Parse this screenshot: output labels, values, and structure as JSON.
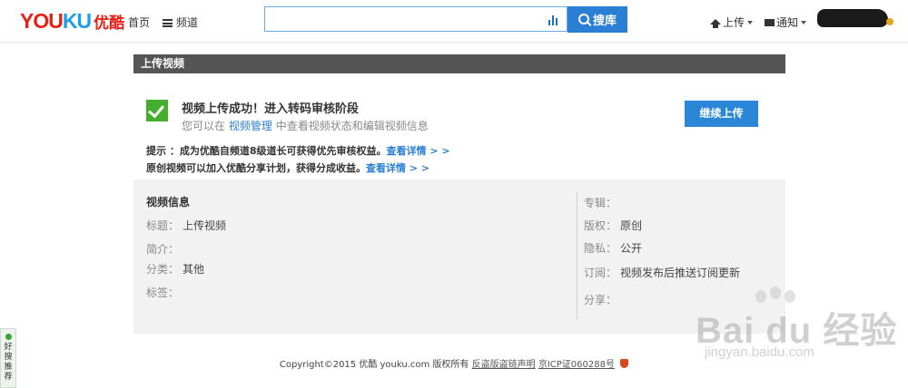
{
  "header": {
    "logo_you": "YOU",
    "logo_ku": "KU",
    "logo_cn": "优酷",
    "nav_home": "首页",
    "nav_channel": "频道",
    "search": {
      "placeholder": "",
      "button_label": "搜库"
    },
    "upload_label": "上传",
    "notify_label": "通知"
  },
  "section": {
    "title": "上传视频"
  },
  "success": {
    "title": "视频上传成功！进入转码审核阶段",
    "sub_prefix": "您可以在",
    "sub_link": "视频管理",
    "sub_suffix": "中查看视频状态和编辑视频信息",
    "continue_button": "继续上传"
  },
  "tips": [
    {
      "text": "提示 ：成为优酷自频道8级道长可获得优先审核权益。",
      "link": "查看详情 > >"
    },
    {
      "text": "原创视频可以加入优酷分享计划，获得分成收益。",
      "link": "查看详情 > >"
    }
  ],
  "info": {
    "title": "视频信息",
    "left": [
      {
        "label": "标题：",
        "value": "上传视频"
      },
      {
        "label": "简介：",
        "value": ""
      },
      {
        "label": "分类：",
        "value": "其他"
      },
      {
        "label": "标签：",
        "value": ""
      }
    ],
    "right": [
      {
        "label": "专辑：",
        "value": ""
      },
      {
        "label": "版权：",
        "value": "原创"
      },
      {
        "label": "隐私：",
        "value": "公开"
      },
      {
        "label": "订阅：",
        "value": "视频发布后推送订阅更新"
      },
      {
        "label": "分享：",
        "value": ""
      }
    ]
  },
  "footer": {
    "copyright": "Copyright©2015 优酷 youku.com 版权所有",
    "link1": "反盗版盗链声明",
    "link2": "京ICP证060288号"
  },
  "side_widget": {
    "text": "好搜推荐"
  },
  "watermark": {
    "main": "Bai du 经验",
    "sub": "jingyan.baidu.com"
  },
  "colors": {
    "accent": "#2a7fd4",
    "success": "#46ae2e",
    "brand_red": "#e62117",
    "section_bar": "#555555"
  }
}
